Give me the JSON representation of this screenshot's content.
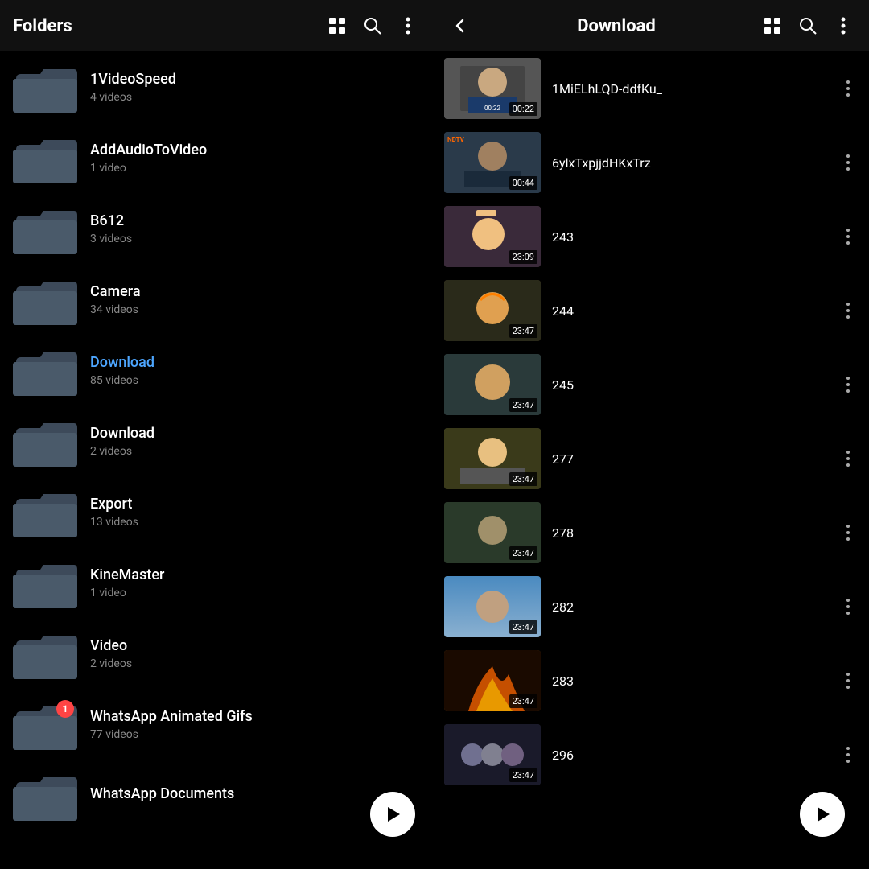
{
  "leftHeader": {
    "title": "Folders",
    "gridIcon": "⊞",
    "searchIcon": "🔍",
    "moreIcon": "⋮"
  },
  "rightHeader": {
    "backIcon": "←",
    "title": "Download",
    "gridIcon": "⊞",
    "searchIcon": "🔍",
    "moreIcon": "⋮"
  },
  "folders": [
    {
      "id": "1videospeed",
      "name": "1VideoSpeed",
      "count": "4 videos",
      "active": false,
      "badge": null
    },
    {
      "id": "addaudiotovideo",
      "name": "AddAudioToVideo",
      "count": "1 video",
      "active": false,
      "badge": null
    },
    {
      "id": "b612",
      "name": "B612",
      "count": "3 videos",
      "active": false,
      "badge": null
    },
    {
      "id": "camera",
      "name": "Camera",
      "count": "34 videos",
      "active": false,
      "badge": null
    },
    {
      "id": "download1",
      "name": "Download",
      "count": "85 videos",
      "active": true,
      "badge": null
    },
    {
      "id": "download2",
      "name": "Download",
      "count": "2 videos",
      "active": false,
      "badge": null
    },
    {
      "id": "export",
      "name": "Export",
      "count": "13 videos",
      "active": false,
      "badge": null
    },
    {
      "id": "kinemaster",
      "name": "KineMaster",
      "count": "1 video",
      "active": false,
      "badge": null
    },
    {
      "id": "video",
      "name": "Video",
      "count": "2 videos",
      "active": false,
      "badge": null
    },
    {
      "id": "whatsapp-gifs",
      "name": "WhatsApp Animated Gifs",
      "count": "77 videos",
      "active": false,
      "badge": "1"
    },
    {
      "id": "whatsapp-docs",
      "name": "WhatsApp Documents",
      "count": "",
      "active": false,
      "badge": null
    }
  ],
  "videos": [
    {
      "id": "v1",
      "name": "1MiELhLQD-ddfKu_",
      "duration": "00:22",
      "thumbClass": "thumb-trump"
    },
    {
      "id": "v2",
      "name": "6ylxTxpjjdHKxTrz",
      "duration": "00:44",
      "thumbClass": "thumb-arvind"
    },
    {
      "id": "v3",
      "name": "243",
      "duration": "23:09",
      "thumbClass": "thumb-tsunade"
    },
    {
      "id": "v4",
      "name": "244",
      "duration": "23:47",
      "thumbClass": "thumb-naruto1"
    },
    {
      "id": "v5",
      "name": "245",
      "duration": "23:47",
      "thumbClass": "thumb-naruto2"
    },
    {
      "id": "v6",
      "name": "277",
      "duration": "23:47",
      "thumbClass": "thumb-minato"
    },
    {
      "id": "v7",
      "name": "278",
      "duration": "23:47",
      "thumbClass": "thumb-shino"
    },
    {
      "id": "v8",
      "name": "282",
      "duration": "23:47",
      "thumbClass": "thumb-gaara"
    },
    {
      "id": "v9",
      "name": "283",
      "duration": "23:47",
      "thumbClass": "thumb-fire"
    },
    {
      "id": "v10",
      "name": "296",
      "duration": "23:47",
      "thumbClass": "thumb-group"
    }
  ],
  "fab": {
    "playIcon": "▶"
  }
}
